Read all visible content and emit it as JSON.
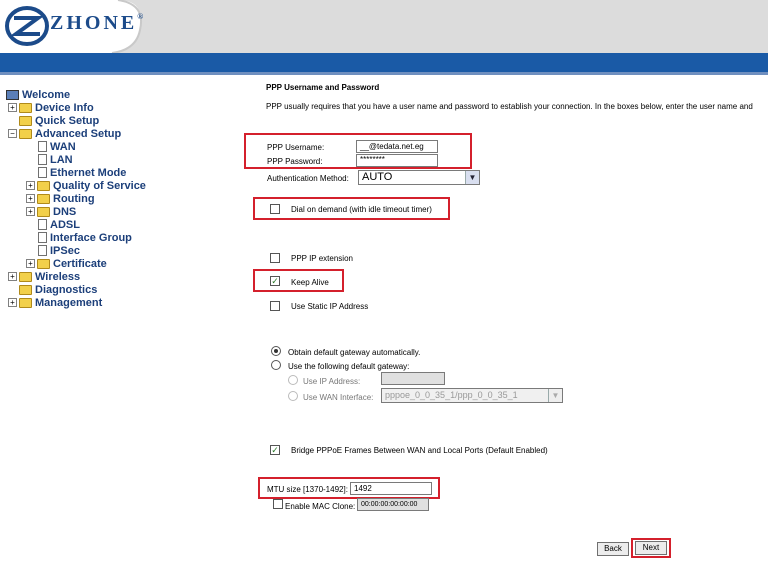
{
  "brand": {
    "logo_text": "ZHONE",
    "logo_mark": "®"
  },
  "nav": {
    "items": [
      {
        "label": "Welcome"
      },
      {
        "label": "Device Info"
      },
      {
        "label": "Quick Setup"
      },
      {
        "label": "Advanced Setup"
      },
      {
        "label": "WAN"
      },
      {
        "label": "LAN"
      },
      {
        "label": "Ethernet Mode"
      },
      {
        "label": "Quality of Service"
      },
      {
        "label": "Routing"
      },
      {
        "label": "DNS"
      },
      {
        "label": "ADSL"
      },
      {
        "label": "Interface Group"
      },
      {
        "label": "IPSec"
      },
      {
        "label": "Certificate"
      },
      {
        "label": "Wireless"
      },
      {
        "label": "Diagnostics"
      },
      {
        "label": "Management"
      }
    ],
    "plus": "+",
    "minus": "−"
  },
  "form": {
    "heading": "PPP Username and Password",
    "description": "PPP usually requires that you have a user name and password to establish your connection. In the boxes below, enter the user name and",
    "username_label": "PPP Username:",
    "username_value": "__@tedata.net.eg",
    "password_label": "PPP Password:",
    "password_value": "********",
    "auth_label": "Authentication Method:",
    "auth_value": "AUTO",
    "dial_on_demand_label": "Dial on demand (with idle timeout timer)",
    "ppp_ip_extension_label": "PPP IP extension",
    "keep_alive_label": "Keep Alive",
    "static_ip_label": "Use Static IP Address",
    "gateway_auto_label": "Obtain default gateway automatically.",
    "gateway_manual_label": "Use the following default gateway:",
    "use_ip_label": "Use IP Address:",
    "use_wan_label": "Use WAN Interface:",
    "wan_interface_value": "pppoe_0_0_35_1/ppp_0_0_35_1",
    "bridge_label": "Bridge PPPoE Frames Between WAN and Local Ports (Default Enabled)",
    "mtu_label": "MTU size [1370-1492]:",
    "mtu_value": "1492",
    "mac_clone_label": "Enable MAC Clone:",
    "mac_value": "00:00:00:00:00:00",
    "check_mark": "✓",
    "back_label": "Back",
    "next_label": "Next"
  }
}
